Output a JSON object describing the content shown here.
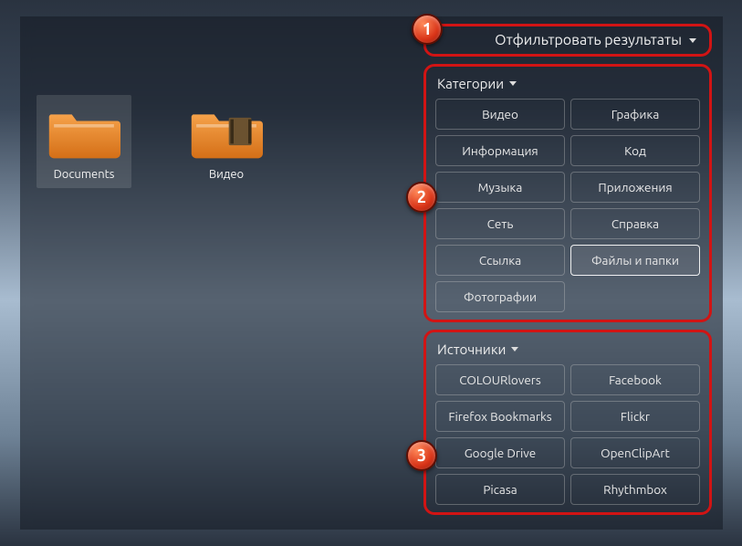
{
  "files": [
    {
      "label": "Documents",
      "kind": "folder",
      "selected": true
    },
    {
      "label": "Видео",
      "kind": "folder-video",
      "selected": false
    }
  ],
  "filter": {
    "label": "Отфильтровать результаты"
  },
  "markers": {
    "one": "1",
    "two": "2",
    "three": "3"
  },
  "categories": {
    "title": "Категории",
    "items": [
      {
        "label": "Видео",
        "active": false
      },
      {
        "label": "Графика",
        "active": false
      },
      {
        "label": "Информация",
        "active": false
      },
      {
        "label": "Код",
        "active": false
      },
      {
        "label": "Музыка",
        "active": false
      },
      {
        "label": "Приложения",
        "active": false
      },
      {
        "label": "Сеть",
        "active": false
      },
      {
        "label": "Справка",
        "active": false
      },
      {
        "label": "Ссылка",
        "active": false
      },
      {
        "label": "Файлы и папки",
        "active": true
      },
      {
        "label": "Фотографии",
        "active": false
      }
    ]
  },
  "sources": {
    "title": "Источники",
    "items": [
      {
        "label": "COLOURlovers"
      },
      {
        "label": "Facebook"
      },
      {
        "label": "Firefox Bookmarks"
      },
      {
        "label": "Flickr"
      },
      {
        "label": "Google Drive"
      },
      {
        "label": "OpenClipArt"
      },
      {
        "label": "Picasa"
      },
      {
        "label": "Rhythmbox"
      }
    ]
  }
}
